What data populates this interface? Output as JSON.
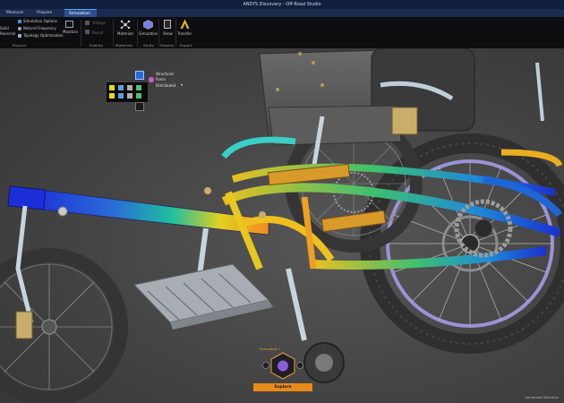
{
  "window": {
    "title": "ANSYS Discovery - Off-Road Studio"
  },
  "tabs": [
    {
      "label": "Measure",
      "active": false
    },
    {
      "label": "Prepare",
      "active": false
    },
    {
      "label": "Simulation",
      "active": true
    }
  ],
  "ribbon": {
    "partial_left_labels": [
      "Solid",
      "Reversal"
    ],
    "physics_menu": [
      "Simulation Options",
      "Natural Frequency",
      "Topology Optimization"
    ],
    "monitors_label": "Monitors",
    "disabled_tools": [
      "Voltage",
      "Result"
    ],
    "groups": {
      "physics": "Physics",
      "fidelity": "Fidelity",
      "materials": "Materials",
      "study": "Study",
      "display": "Display",
      "export": "Export"
    },
    "buttons": {
      "materials": "Materials",
      "simulation": "Simulation",
      "show": "Show",
      "transfer": "Transfer"
    }
  },
  "context_panel": {
    "heading": "Structural",
    "force": "Force",
    "distributed": "Distributed"
  },
  "bottom": {
    "simulation_label": "Simulation 1",
    "explore": "Explore"
  },
  "status": {
    "right_text": "Advanced Selection"
  },
  "colors": {
    "accent": "#e8891a",
    "ribbon_bg": "#0e0e10",
    "tab_bg": "#1a2b4d",
    "title_bg": "#0f1f3d"
  }
}
